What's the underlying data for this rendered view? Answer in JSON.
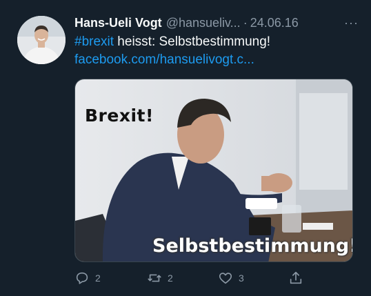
{
  "tweet": {
    "author_name": "Hans-Ueli Vogt",
    "author_handle": "@hansueliv...",
    "separator": "·",
    "date": "24.06.16",
    "more_label": "···",
    "hashtag": "#brexit",
    "text_rest": " heisst: Selbstbestimmung!",
    "link": "facebook.com/hansuelivogt.c...",
    "media": {
      "caption_top": "Brexit!",
      "caption_bottom": "Selbstbestimmung!"
    },
    "actions": {
      "reply_count": "2",
      "retweet_count": "2",
      "like_count": "3"
    }
  },
  "icons": [
    "reply-icon",
    "retweet-icon",
    "like-icon",
    "share-icon",
    "more-icon"
  ],
  "colors": {
    "background": "#15202b",
    "link": "#1d9bf0",
    "muted": "#8b98a5",
    "text": "#f7f9f9"
  }
}
